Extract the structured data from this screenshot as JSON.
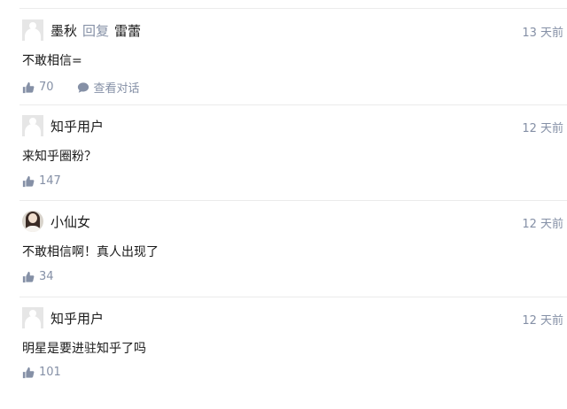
{
  "comments": [
    {
      "author": "墨秋",
      "reply_label": "回复",
      "reply_to": "雷蕾",
      "time": "13 天前",
      "content": "不敢相信=",
      "likes": "70",
      "conversation_label": "查看对话"
    },
    {
      "author": "知乎用户",
      "time": "12 天前",
      "content": "来知乎圈粉？",
      "likes": "147"
    },
    {
      "author": "小仙女",
      "time": "12 天前",
      "content": "不敢相信啊！真人出现了",
      "likes": "34"
    },
    {
      "author": "知乎用户",
      "time": "12 天前",
      "content": "明星是要进驻知乎了吗",
      "likes": "101"
    }
  ],
  "icons": {
    "like": "thumbs-up-icon",
    "conversation": "speech-bubble-icon",
    "default_avatar": "default-avatar-icon",
    "photo_avatar": "user-photo-avatar"
  },
  "colors": {
    "meta": "#8590a6",
    "text": "#1a1a1a",
    "divider": "#ebebeb",
    "avatar_placeholder": "#e6e6e6"
  }
}
